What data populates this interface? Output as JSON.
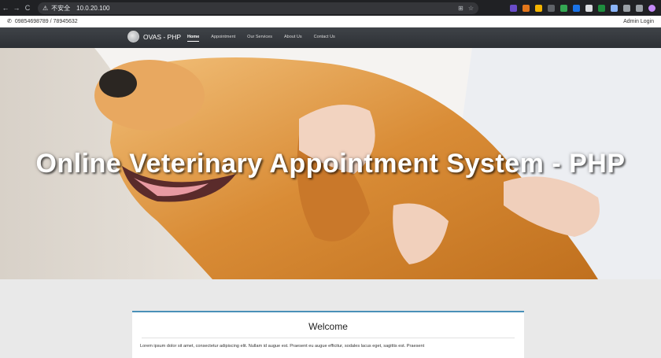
{
  "browser": {
    "back": "←",
    "forward": "→",
    "reload": "C",
    "security_label": "不安全",
    "url": "10.0.20.100"
  },
  "topbar": {
    "phone": "09854698789 / 78945632",
    "admin_login": "Admin Login"
  },
  "navbar": {
    "brand": "OVAS - PHP",
    "links": [
      "Home",
      "Appointment",
      "Our Services",
      "About Us",
      "Contact Us"
    ],
    "active": "Home"
  },
  "hero": {
    "title": "Online Veterinary Appointment System - PHP"
  },
  "welcome": {
    "title": "Welcome",
    "text": "Lorem ipsum dolor sit amet, consectetur adipiscing elit. Nullam id augue est. Praesent eu augue efficitur, sodales lacus eget, sagittis est. Praesent"
  },
  "colors": {
    "navbar": "#2d3035",
    "accent": "#4a90b8",
    "page_bg": "#e9e9e9"
  }
}
